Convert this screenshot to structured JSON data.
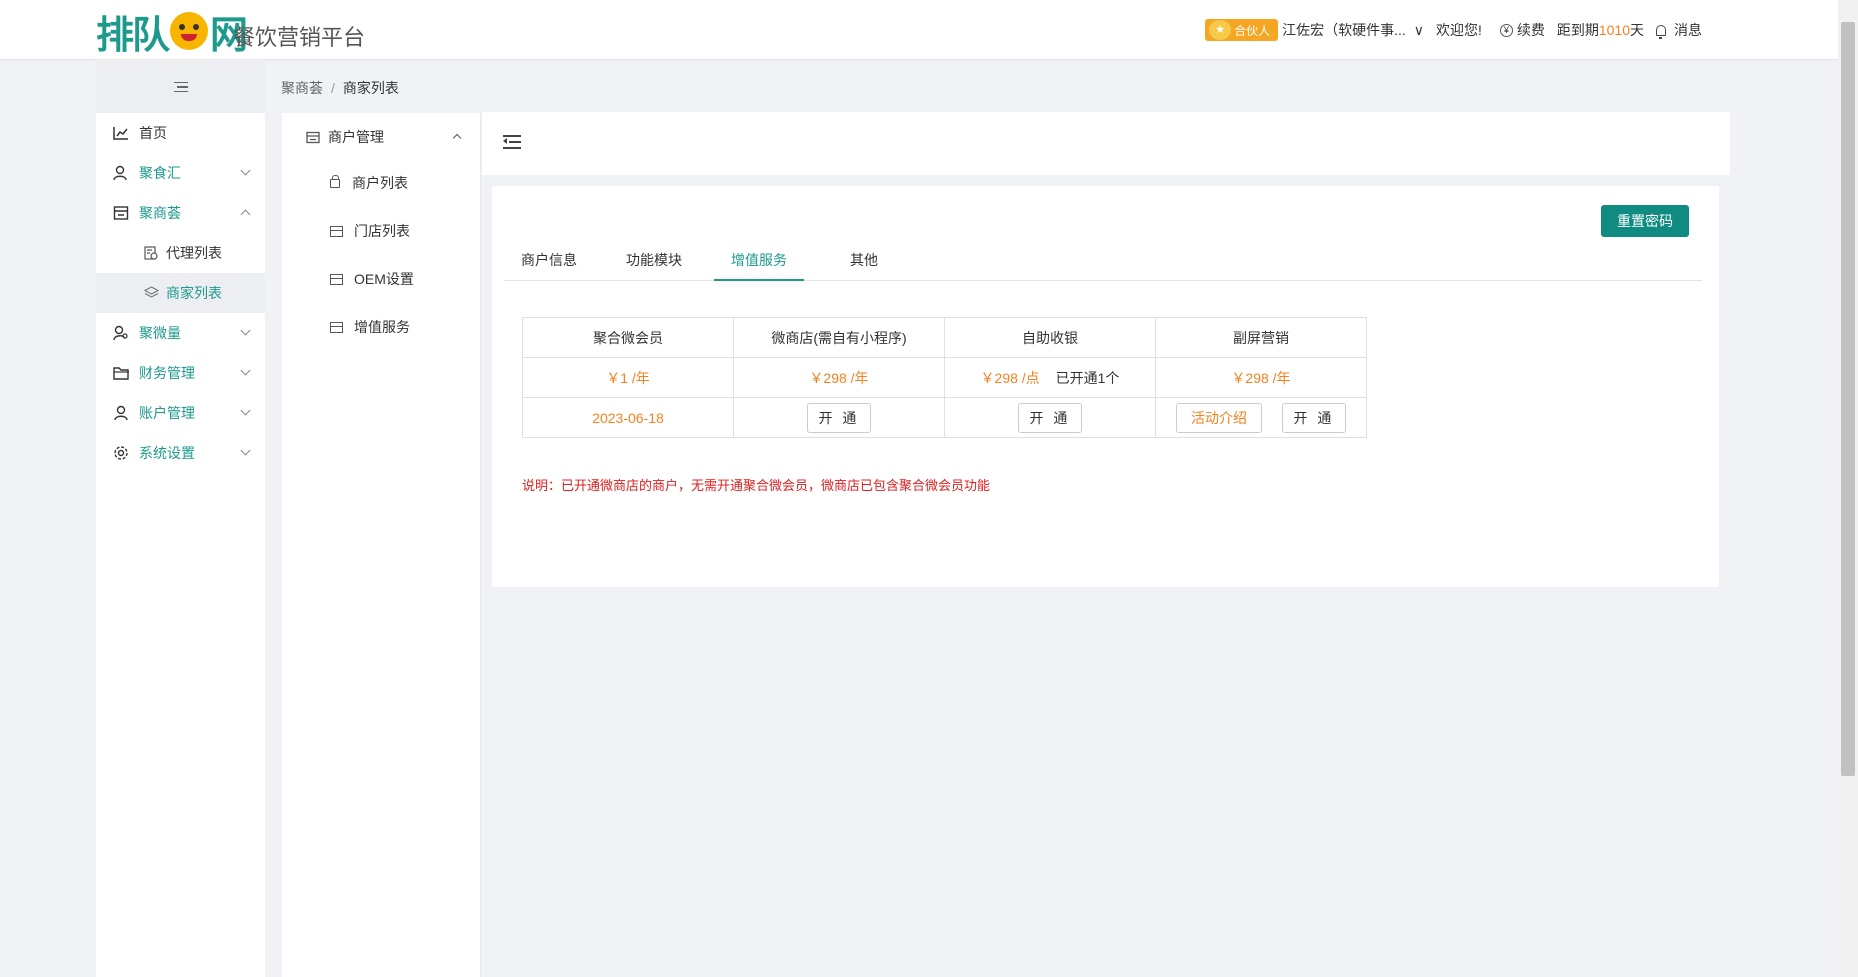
{
  "header": {
    "logo_text": "排队网",
    "platform_name": "餐饮营销平台",
    "partner_label": "合伙人",
    "user_name": "江佐宏（软硬件事...",
    "welcome": "欢迎您!",
    "renew_label": "续费",
    "expire_prefix": "距到期",
    "expire_days": "1010",
    "expire_suffix": "天",
    "messages_label": "消息"
  },
  "sidebar": {
    "items": [
      {
        "label": "首页"
      },
      {
        "label": "聚食汇"
      },
      {
        "label": "聚商荟"
      },
      {
        "label": "代理列表"
      },
      {
        "label": "商家列表"
      },
      {
        "label": "聚微量"
      },
      {
        "label": "财务管理"
      },
      {
        "label": "账户管理"
      },
      {
        "label": "系统设置"
      }
    ]
  },
  "breadcrumb": {
    "parent": "聚商荟",
    "separator": "/",
    "current": "商家列表"
  },
  "subnav": {
    "header": "商户管理",
    "items": [
      {
        "label": "商户列表"
      },
      {
        "label": "门店列表"
      },
      {
        "label": "OEM设置"
      },
      {
        "label": "增值服务"
      }
    ]
  },
  "card": {
    "reset_button": "重置密码",
    "tabs": [
      {
        "label": "商户信息"
      },
      {
        "label": "功能模块"
      },
      {
        "label": "增值服务"
      },
      {
        "label": "其他"
      }
    ],
    "table": {
      "headers": [
        "聚合微会员",
        "微商店(需自有小程序)",
        "自助收银",
        "副屏营销"
      ],
      "prices": [
        "￥1 /年",
        "￥298 /年",
        "￥298 /点",
        "￥298 /年"
      ],
      "cashier_opened": "已开通1个",
      "member_expire": "2023-06-18",
      "open_button": "开 通",
      "intro_button": "活动介绍"
    },
    "note": "说明：已开通微商店的商户，无需开通聚合微会员，微商店已包含聚合微会员功能"
  },
  "colors": {
    "brand": "#1d9a8c",
    "accent": "#f5821f",
    "warning_text": "#e02020",
    "button": "#0f8b82"
  }
}
